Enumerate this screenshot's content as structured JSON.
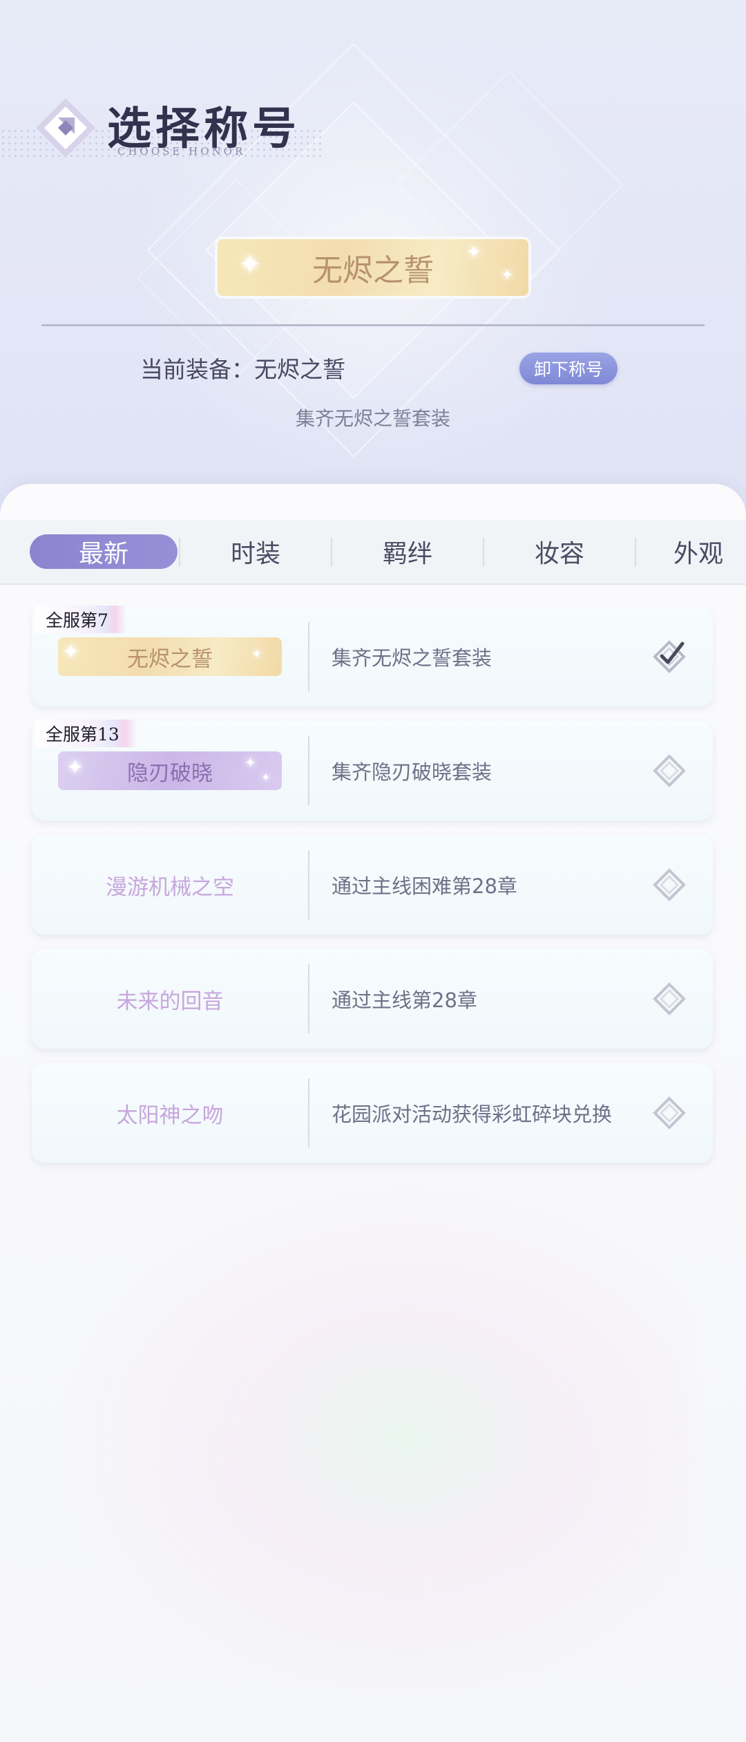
{
  "header": {
    "title": "选择称号",
    "subtitle": "CHOOSE HONOR"
  },
  "current": {
    "badge_name": "无烬之誓",
    "equip_label": "当前装备：无烬之誓",
    "unequip_label": "卸下称号",
    "description": "集齐无烬之誓套装"
  },
  "tabs": [
    {
      "label": "最新",
      "active": true
    },
    {
      "label": "时装",
      "active": false
    },
    {
      "label": "羁绊",
      "active": false
    },
    {
      "label": "妆容",
      "active": false
    },
    {
      "label": "外观",
      "active": false
    }
  ],
  "titles": [
    {
      "rank": "全服第7",
      "name": "无烬之誓",
      "style": "gold",
      "condition": "集齐无烬之誓套装",
      "state": "equipped"
    },
    {
      "rank": "全服第13",
      "name": "隐刃破晓",
      "style": "purple",
      "condition": "集齐隐刃破晓套装",
      "state": "owned"
    },
    {
      "rank": "",
      "name": "漫游机械之空",
      "style": "text",
      "condition": "通过主线困难第28章",
      "state": "locked"
    },
    {
      "rank": "",
      "name": "未来的回音",
      "style": "text",
      "condition": "通过主线第28章",
      "state": "locked"
    },
    {
      "rank": "",
      "name": "太阳神之吻",
      "style": "text",
      "condition": "花园派对活动获得彩虹碎块兑换",
      "state": "locked"
    }
  ],
  "colors": {
    "accent": "#8c84cf",
    "button": "#8a93dd",
    "gold_badge": "#f3ddb0",
    "purple_badge": "#cbb7e7",
    "locked_name": "#c7a6dc"
  },
  "icons": {
    "title_mark": "diamond-logo-icon",
    "equipped": "diamond-check-icon",
    "not_equipped": "diamond-outline-icon"
  }
}
